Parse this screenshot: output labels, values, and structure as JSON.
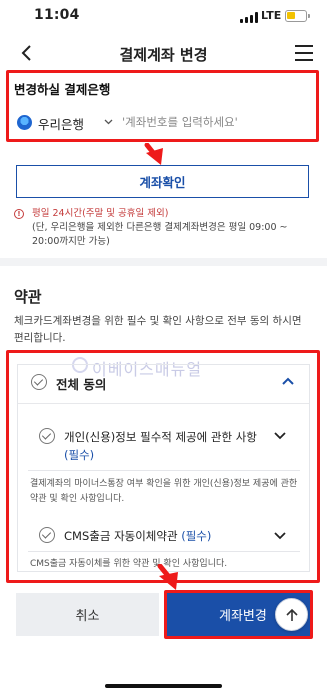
{
  "status_bar": {
    "time": "11:04",
    "network": "LTE",
    "battery_fill": 0.4,
    "battery_color": "#f2c200"
  },
  "header": {
    "title": "결제계좌 변경",
    "back_icon": "chevron-left-icon",
    "menu_icon": "hamburger-menu-icon"
  },
  "bank_section": {
    "heading": "변경하실 결제은행",
    "selected_bank": "우리은행",
    "account_placeholder": "'계좌번호를 입력하세요'"
  },
  "confirm_button": {
    "label": "계좌확인"
  },
  "notice": {
    "line1": "평일 24시간(주말 및 공휴일 제외)",
    "line2": "(단, 우리은행을 제외한 다른은행 결제계좌변경은 평일 09:00 ~ 20:00까지만 가능)"
  },
  "terms": {
    "title": "약관",
    "description": "체크카드계좌변경을 위한 필수 및 확인 사항으로 전부 동의 하시면 편리합니다.",
    "watermark": "이베이스매뉴얼",
    "all_agree_label": "전체 동의",
    "items": [
      {
        "label": "개인(신용)정보 필수적 제공에 관한 사항",
        "required": "(필수)",
        "description": "결제계좌의 마이너스통장 여부 확인을 위한 개인(신용)정보 제공에 관한 약관 및 확인 사항입니다."
      },
      {
        "label": "CMS출금 자동이체약관",
        "required": "(필수)",
        "description": "CMS출금 자동이체를 위한 약관 및 확인 사항입니다."
      }
    ]
  },
  "bottom": {
    "cancel_label": "취소",
    "change_label": "계좌변경",
    "top_icon": "arrow-up-icon"
  },
  "colors": {
    "accent": "#1a4fa8",
    "highlight": "#ee1a1a",
    "notice": "#c43b3b"
  }
}
